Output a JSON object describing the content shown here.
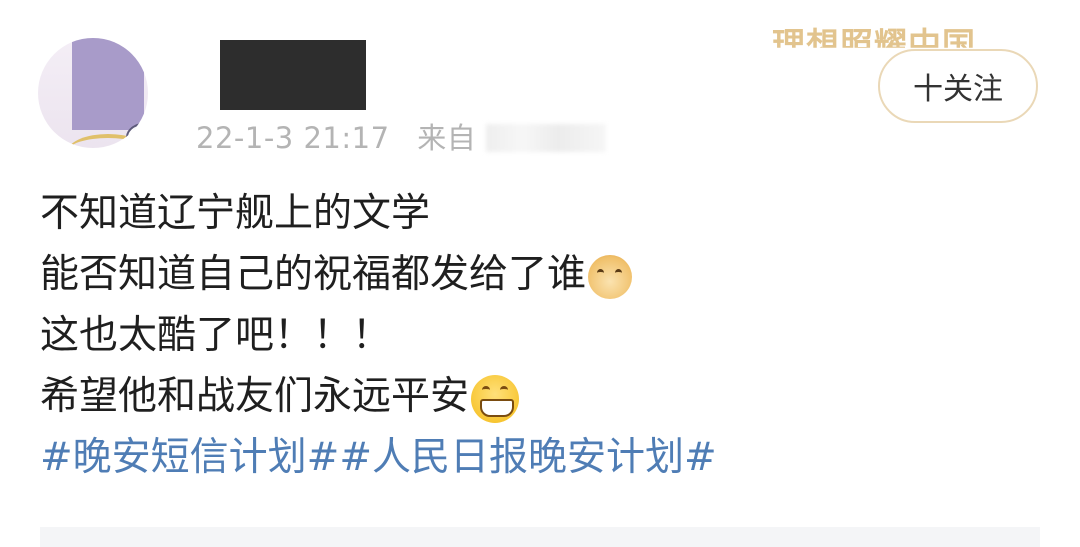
{
  "post": {
    "time": "22-1-3 21:17",
    "source_prefix": "来自",
    "lines": [
      "不知道辽宁舰上的文学",
      "能否知道自己的祝福都发给了谁",
      "这也太酷了吧！！！",
      "希望他和战友们永远平安"
    ],
    "tags": "#晚安短信计划##人民日报晚安计划#"
  },
  "header": {
    "follow_label": "十关注",
    "watermark": "理想照耀中国"
  },
  "icons": {
    "doge": "doge-emoji-icon",
    "grin": "grinning-emoji-icon"
  }
}
